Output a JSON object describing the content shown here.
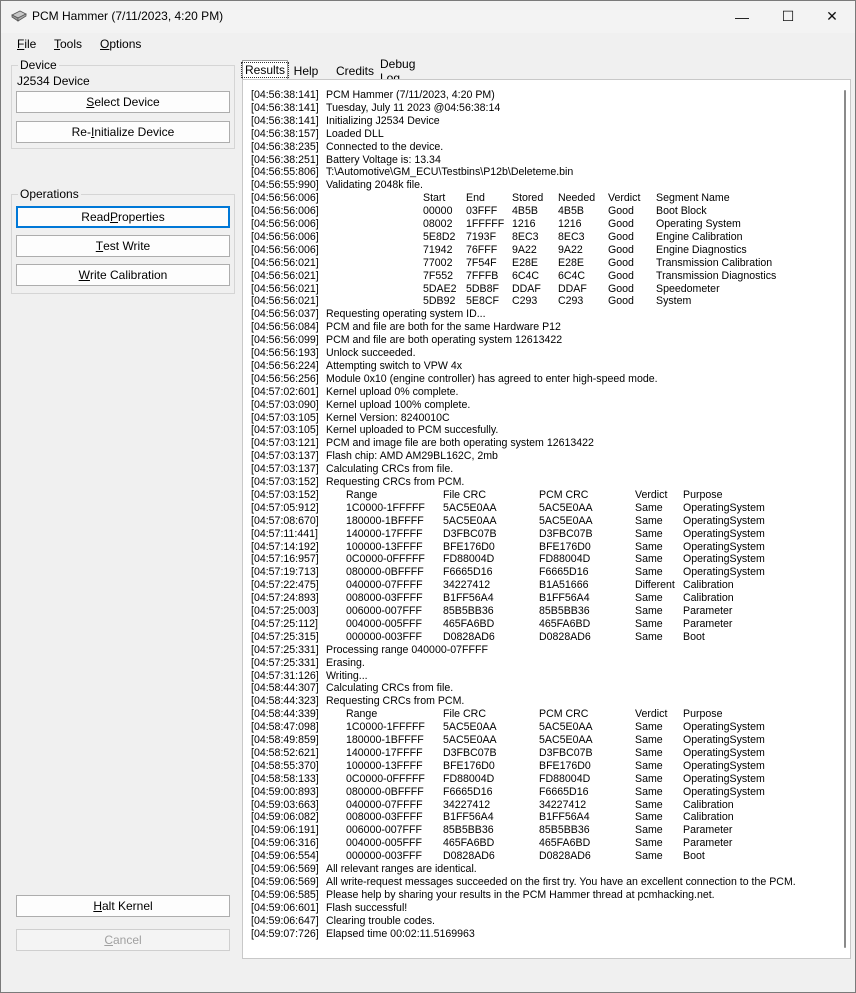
{
  "window": {
    "title": "PCM Hammer (7/11/2023, 4:20 PM)",
    "controls": {
      "minimize": "—",
      "maximize": "☐",
      "close": "✕"
    }
  },
  "menu": {
    "file": {
      "accel": "F",
      "rest": "ile"
    },
    "tools": {
      "accel": "T",
      "rest": "ools"
    },
    "options": {
      "accel": "O",
      "rest": "ptions"
    }
  },
  "device_group": {
    "legend": "Device",
    "device_name": "J2534 Device",
    "select_device": {
      "pre": "",
      "accel": "S",
      "post": "elect Device"
    },
    "reinit_device": {
      "pre": "Re-",
      "accel": "I",
      "post": "nitialize Device"
    }
  },
  "operations_group": {
    "legend": "Operations",
    "read_properties": {
      "pre": "Read ",
      "accel": "P",
      "post": "roperties"
    },
    "test_write": {
      "pre": "",
      "accel": "T",
      "post": "est Write"
    },
    "write_calibration": {
      "pre": "",
      "accel": "W",
      "post": "rite Calibration"
    }
  },
  "bottom_buttons": {
    "halt_kernel": {
      "pre": "",
      "accel": "H",
      "post": "alt Kernel"
    },
    "cancel": {
      "pre": "",
      "accel": "C",
      "post": "ancel"
    }
  },
  "tabs": [
    "Results",
    "Help",
    "Credits",
    "Debug Log"
  ],
  "log_lines": [
    [
      "[04:56:38:141]",
      "PCM Hammer (7/11/2023, 4:20 PM)"
    ],
    [
      "[04:56:38:141]",
      "Tuesday, July 11 2023 @04:56:38:14"
    ],
    [
      "[04:56:38:141]",
      "Initializing J2534 Device"
    ],
    [
      "[04:56:38:157]",
      "Loaded DLL"
    ],
    [
      "[04:56:38:235]",
      "Connected to the device."
    ],
    [
      "[04:56:38:251]",
      "Battery Voltage is: 13.34"
    ],
    [
      "[04:56:55:806]",
      "T:\\Automotive\\GM_ECU\\Testbins\\P12b\\Deleteme.bin"
    ],
    [
      "[04:56:55:990]",
      "Validating 2048k file."
    ],
    [
      "[04:56:56:006]",
      "",
      [
        "Start",
        "End",
        "Stored",
        "Needed",
        "Verdict",
        "Segment Name"
      ]
    ],
    [
      "[04:56:56:006]",
      "",
      [
        "00000",
        "03FFF",
        "4B5B",
        "4B5B",
        "Good",
        "Boot Block"
      ]
    ],
    [
      "[04:56:56:006]",
      "",
      [
        "08002",
        "1FFFFF",
        "1216",
        "1216",
        "Good",
        "Operating System"
      ]
    ],
    [
      "[04:56:56:006]",
      "",
      [
        "5E8D2",
        "7193F",
        "8EC3",
        "8EC3",
        "Good",
        "Engine Calibration"
      ]
    ],
    [
      "[04:56:56:006]",
      "",
      [
        "71942",
        "76FFF",
        "9A22",
        "9A22",
        "Good",
        "Engine Diagnostics"
      ]
    ],
    [
      "[04:56:56:021]",
      "",
      [
        "77002",
        "7F54F",
        "E28E",
        "E28E",
        "Good",
        "Transmission Calibration"
      ]
    ],
    [
      "[04:56:56:021]",
      "",
      [
        "7F552",
        "7FFFB",
        "6C4C",
        "6C4C",
        "Good",
        "Transmission Diagnostics"
      ]
    ],
    [
      "[04:56:56:021]",
      "",
      [
        "5DAE2",
        "5DB8F",
        "DDAF",
        "DDAF",
        "Good",
        "Speedometer"
      ]
    ],
    [
      "[04:56:56:021]",
      "",
      [
        "5DB92",
        "5E8CF",
        "C293",
        "C293",
        "Good",
        "System"
      ]
    ],
    [
      "[04:56:56:037]",
      "Requesting operating system ID..."
    ],
    [
      "[04:56:56:084]",
      "PCM and file are both for the same Hardware P12"
    ],
    [
      "[04:56:56:099]",
      "PCM and file are both operating system 12613422"
    ],
    [
      "[04:56:56:193]",
      "Unlock succeeded."
    ],
    [
      "[04:56:56:224]",
      "Attempting switch to VPW 4x"
    ],
    [
      "[04:56:56:256]",
      "Module 0x10 (engine controller) has agreed to enter high-speed mode."
    ],
    [
      "[04:57:02:601]",
      "Kernel upload 0% complete."
    ],
    [
      "[04:57:03:090]",
      "Kernel upload 100% complete."
    ],
    [
      "[04:57:03:105]",
      "Kernel Version: 8240010C"
    ],
    [
      "[04:57:03:105]",
      "Kernel uploaded to PCM succesfully."
    ],
    [
      "[04:57:03:121]",
      "PCM and image file are both operating system 12613422"
    ],
    [
      "[04:57:03:137]",
      "Flash chip: AMD AM29BL162C, 2mb"
    ],
    [
      "[04:57:03:137]",
      "Calculating CRCs from file."
    ],
    [
      "[04:57:03:152]",
      "Requesting CRCs from PCM."
    ],
    [
      "[04:57:03:152]",
      "",
      [
        "Range",
        "File CRC",
        "PCM CRC",
        "Verdict",
        "Purpose"
      ]
    ],
    [
      "[04:57:05:912]",
      "",
      [
        "1C0000-1FFFFF",
        "5AC5E0AA",
        "5AC5E0AA",
        "Same",
        "OperatingSystem"
      ]
    ],
    [
      "[04:57:08:670]",
      "",
      [
        "180000-1BFFFF",
        "5AC5E0AA",
        "5AC5E0AA",
        "Same",
        "OperatingSystem"
      ]
    ],
    [
      "[04:57:11:441]",
      "",
      [
        "140000-17FFFF",
        "D3FBC07B",
        "D3FBC07B",
        "Same",
        "OperatingSystem"
      ]
    ],
    [
      "[04:57:14:192]",
      "",
      [
        "100000-13FFFF",
        "BFE176D0",
        "BFE176D0",
        "Same",
        "OperatingSystem"
      ]
    ],
    [
      "[04:57:16:957]",
      "",
      [
        "0C0000-0FFFFF",
        "FD88004D",
        "FD88004D",
        "Same",
        "OperatingSystem"
      ]
    ],
    [
      "[04:57:19:713]",
      "",
      [
        "080000-0BFFFF",
        "F6665D16",
        "F6665D16",
        "Same",
        "OperatingSystem"
      ]
    ],
    [
      "[04:57:22:475]",
      "",
      [
        "040000-07FFFF",
        "34227412",
        "B1A51666",
        "Different",
        "Calibration"
      ]
    ],
    [
      "[04:57:24:893]",
      "",
      [
        "008000-03FFFF",
        "B1FF56A4",
        "B1FF56A4",
        "Same",
        "Calibration"
      ]
    ],
    [
      "[04:57:25:003]",
      "",
      [
        "006000-007FFF",
        "85B5BB36",
        "85B5BB36",
        "Same",
        "Parameter"
      ]
    ],
    [
      "[04:57:25:112]",
      "",
      [
        "004000-005FFF",
        "465FA6BD",
        "465FA6BD",
        "Same",
        "Parameter"
      ]
    ],
    [
      "[04:57:25:315]",
      "",
      [
        "000000-003FFF",
        "D0828AD6",
        "D0828AD6",
        "Same",
        "Boot"
      ]
    ],
    [
      "[04:57:25:331]",
      "Processing range 040000-07FFFF"
    ],
    [
      "[04:57:25:331]",
      "Erasing."
    ],
    [
      "[04:57:31:126]",
      "Writing..."
    ],
    [
      "[04:58:44:307]",
      "Calculating CRCs from file."
    ],
    [
      "[04:58:44:323]",
      "Requesting CRCs from PCM."
    ],
    [
      "[04:58:44:339]",
      "",
      [
        "Range",
        "File CRC",
        "PCM CRC",
        "Verdict",
        "Purpose"
      ]
    ],
    [
      "[04:58:47:098]",
      "",
      [
        "1C0000-1FFFFF",
        "5AC5E0AA",
        "5AC5E0AA",
        "Same",
        "OperatingSystem"
      ]
    ],
    [
      "[04:58:49:859]",
      "",
      [
        "180000-1BFFFF",
        "5AC5E0AA",
        "5AC5E0AA",
        "Same",
        "OperatingSystem"
      ]
    ],
    [
      "[04:58:52:621]",
      "",
      [
        "140000-17FFFF",
        "D3FBC07B",
        "D3FBC07B",
        "Same",
        "OperatingSystem"
      ]
    ],
    [
      "[04:58:55:370]",
      "",
      [
        "100000-13FFFF",
        "BFE176D0",
        "BFE176D0",
        "Same",
        "OperatingSystem"
      ]
    ],
    [
      "[04:58:58:133]",
      "",
      [
        "0C0000-0FFFFF",
        "FD88004D",
        "FD88004D",
        "Same",
        "OperatingSystem"
      ]
    ],
    [
      "[04:59:00:893]",
      "",
      [
        "080000-0BFFFF",
        "F6665D16",
        "F6665D16",
        "Same",
        "OperatingSystem"
      ]
    ],
    [
      "[04:59:03:663]",
      "",
      [
        "040000-07FFFF",
        "34227412",
        "34227412",
        "Same",
        "Calibration"
      ]
    ],
    [
      "[04:59:06:082]",
      "",
      [
        "008000-03FFFF",
        "B1FF56A4",
        "B1FF56A4",
        "Same",
        "Calibration"
      ]
    ],
    [
      "[04:59:06:191]",
      "",
      [
        "006000-007FFF",
        "85B5BB36",
        "85B5BB36",
        "Same",
        "Parameter"
      ]
    ],
    [
      "[04:59:06:316]",
      "",
      [
        "004000-005FFF",
        "465FA6BD",
        "465FA6BD",
        "Same",
        "Parameter"
      ]
    ],
    [
      "[04:59:06:554]",
      "",
      [
        "000000-003FFF",
        "D0828AD6",
        "D0828AD6",
        "Same",
        "Boot"
      ]
    ],
    [
      "[04:59:06:569]",
      "All relevant ranges are identical."
    ],
    [
      "[04:59:06:569]",
      "All write-request messages succeeded on the first try. You have an excellent connection to the PCM."
    ],
    [
      "[04:59:06:585]",
      "Please help by sharing your results in the PCM Hammer thread at pcmhacking.net."
    ],
    [
      "[04:59:06:601]",
      "Flash successful!"
    ],
    [
      "[04:59:06:647]",
      "Clearing trouble codes."
    ],
    [
      "[04:59:07:726]",
      "Elapsed time 00:02:11.5169963"
    ]
  ]
}
